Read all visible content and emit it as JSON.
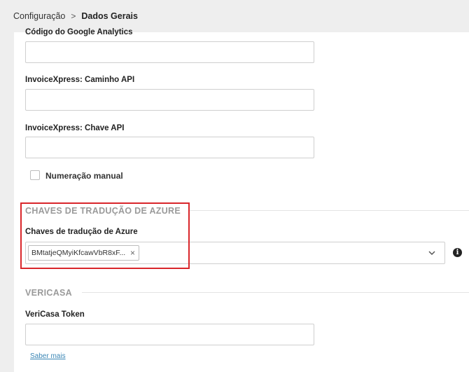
{
  "breadcrumb": {
    "parent": "Configuração",
    "separator": ">",
    "current": "Dados Gerais"
  },
  "fields": {
    "google_analytics_label": "Código do Google Analytics",
    "invoicexpress_path_label": "InvoiceXpress: Caminho API",
    "invoicexpress_key_label": "InvoiceXpress: Chave API"
  },
  "checkbox": {
    "label": "Numeração manual",
    "checked": false
  },
  "azure": {
    "section_title": "CHAVES DE TRADUÇÃO DE AZURE",
    "field_label": "Chaves de tradução de Azure",
    "tag_value": "BMtatjeQMyiKfcawVbR8xF...",
    "tag_remove": "×",
    "info_icon": "i"
  },
  "vericasa": {
    "section_title": "VERICASA",
    "token_label": "VeriCasa Token",
    "learn_more": "Saber mais"
  },
  "colors": {
    "highlight": "#d9262b",
    "link": "#3a86b5",
    "section_title": "#9a9a9a"
  }
}
